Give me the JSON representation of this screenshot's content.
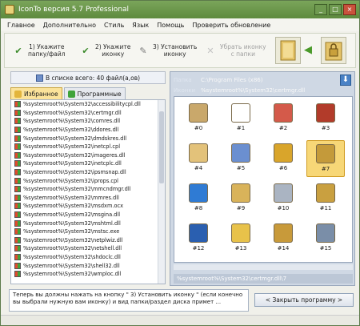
{
  "window": {
    "title": "IconTo версия 5.7 Professional"
  },
  "menu": [
    "Главное",
    "Дополнительно",
    "Стиль",
    "Язык",
    "Помощь",
    "Проверить обновление"
  ],
  "wizard": {
    "step1": "1) Укажите\nпапку/файл",
    "step2": "2) Укажите\nиконку",
    "step3": "3) Установить\nиконку",
    "step4": "Убрать иконку\nс папки"
  },
  "left_panel": {
    "count_label": "В списке всего: 40 файл(а,ов)",
    "tabs": [
      "Избранное",
      "Программные"
    ],
    "files": [
      "%systemroot%\\System32\\accessibilitycpl.dll",
      "%systemroot%\\System32\\certmgr.dll",
      "%systemroot%\\System32\\comres.dll",
      "%systemroot%\\System32\\ddores.dll",
      "%systemroot%\\System32\\dmdskres.dll",
      "%systemroot%\\System32\\inetcpl.cpl",
      "%systemroot%\\System32\\imageres.dll",
      "%systemroot%\\System32\\inetcplc.dll",
      "%systemroot%\\System32\\ipsmsnap.dll",
      "%systemroot%\\System32\\iprops.cpl",
      "%systemroot%\\System32\\mmcndmgr.dll",
      "%systemroot%\\System32\\mmres.dll",
      "%systemroot%\\System32\\msdxm.ocx",
      "%systemroot%\\System32\\msgina.dll",
      "%systemroot%\\System32\\mshtml.dll",
      "%systemroot%\\System32\\mstsc.exe",
      "%systemroot%\\System32\\netplwiz.dll",
      "%systemroot%\\System32\\netshell.dll",
      "%systemroot%\\System32\\shdoclc.dll",
      "%systemroot%\\System32\\shell32.dll",
      "%systemroot%\\System32\\wmploc.dll"
    ]
  },
  "right_panel": {
    "folder_key": "Папка",
    "folder_val": "C:\\Program Files (x86)",
    "icons_key": "Иконки",
    "icons_val": "%systemroot%\\System32\\certmgr.dll",
    "icons": [
      {
        "label": "#0",
        "color": "#c9a86b"
      },
      {
        "label": "#1",
        "color": "#ffffff"
      },
      {
        "label": "#2",
        "color": "#d45a4a"
      },
      {
        "label": "#3",
        "color": "#b23b2a"
      },
      {
        "label": "#4",
        "color": "#e3c27a"
      },
      {
        "label": "#5",
        "color": "#6b8fd0"
      },
      {
        "label": "#6",
        "color": "#d9a52b"
      },
      {
        "label": "#7",
        "color": "#c49a3a"
      },
      {
        "label": "#8",
        "color": "#2f7bd4"
      },
      {
        "label": "#9",
        "color": "#d9b35a"
      },
      {
        "label": "#10",
        "color": "#aab4c2"
      },
      {
        "label": "#11",
        "color": "#c9a040"
      },
      {
        "label": "#12",
        "color": "#2a5fb0"
      },
      {
        "label": "#13",
        "color": "#e8c24a"
      },
      {
        "label": "#14",
        "color": "#c89a3a"
      },
      {
        "label": "#15",
        "color": "#7a8ea8"
      }
    ],
    "selected_index": 7,
    "status_path": "%systemroot%\\System32\\certmgr.dll\\7"
  },
  "bottom": {
    "message": "Теперь вы должны нажать на кнопку \" 3) Установить иконку \" (если конечно вы выбрали нужную вам иконку) и вид папки/раздел диска примет ...",
    "close_button": "< Закрыть программу >"
  }
}
